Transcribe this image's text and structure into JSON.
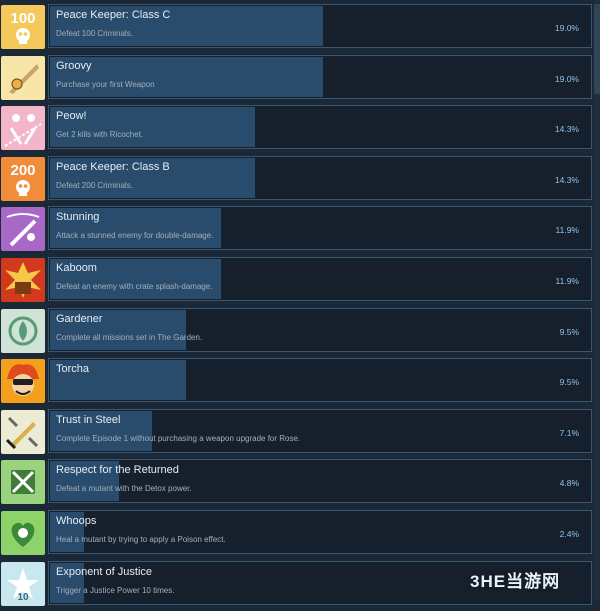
{
  "achievements": [
    {
      "name": "Peace Keeper: Class C",
      "description": "Defeat 100 Criminals.",
      "percent": "19.0%",
      "fill": 19.0,
      "icon": "skull-100-icon",
      "icon_text": "100",
      "icon_bg": "#f5c85c"
    },
    {
      "name": "Groovy",
      "description": "Purchase your first Weapon",
      "percent": "19.0%",
      "fill": 19.0,
      "icon": "weapon-icon",
      "icon_text": "",
      "icon_bg": "#f7e6a8"
    },
    {
      "name": "Peow!",
      "description": "Get 2 kills with Ricochet.",
      "percent": "14.3%",
      "fill": 14.3,
      "icon": "ricochet-icon",
      "icon_text": "",
      "icon_bg": "#f3b6c9"
    },
    {
      "name": "Peace Keeper: Class B",
      "description": "Defeat 200 Criminals.",
      "percent": "14.3%",
      "fill": 14.3,
      "icon": "skull-200-icon",
      "icon_text": "200",
      "icon_bg": "#f08c3a"
    },
    {
      "name": "Stunning",
      "description": "Attack a stunned enemy for double-damage.",
      "percent": "11.9%",
      "fill": 11.9,
      "icon": "stun-icon",
      "icon_text": "",
      "icon_bg": "#a768c7"
    },
    {
      "name": "Kaboom",
      "description": "Defeat an enemy with crate splash-damage.",
      "percent": "11.9%",
      "fill": 11.9,
      "icon": "explosion-icon",
      "icon_text": "",
      "icon_bg": "#d2391d"
    },
    {
      "name": "Gardener",
      "description": "Complete all missions set in The Garden.",
      "percent": "9.5%",
      "fill": 9.5,
      "icon": "garden-icon",
      "icon_text": "",
      "icon_bg": "#cfe3d6"
    },
    {
      "name": "Torcha",
      "description": "",
      "percent": "9.5%",
      "fill": 9.5,
      "icon": "torcha-face-icon",
      "icon_text": "",
      "icon_bg": "#f4a01c"
    },
    {
      "name": "Trust in Steel",
      "description": "Complete Episode 1 without purchasing a weapon upgrade for Rose.",
      "percent": "7.1%",
      "fill": 7.1,
      "icon": "sword-icon",
      "icon_text": "",
      "icon_bg": "#ecebd3"
    },
    {
      "name": "Respect for the Returned",
      "description": "Defeat a mutant with the Detox power.",
      "percent": "4.8%",
      "fill": 4.8,
      "icon": "detox-icon",
      "icon_text": "",
      "icon_bg": "#9bd27e"
    },
    {
      "name": "Whoops",
      "description": "Heal a mutant by trying to apply a Poison effect.",
      "percent": "2.4%",
      "fill": 2.4,
      "icon": "poison-heart-icon",
      "icon_text": "",
      "icon_bg": "#8ed36a"
    },
    {
      "name": "Exponent of Justice",
      "description": "Trigger a Justice Power 10 times.",
      "percent": "",
      "fill": 2.4,
      "icon": "justice-10-icon",
      "icon_text": "10",
      "icon_bg": "#c9e7ee"
    }
  ],
  "watermark": "3HE当游网"
}
